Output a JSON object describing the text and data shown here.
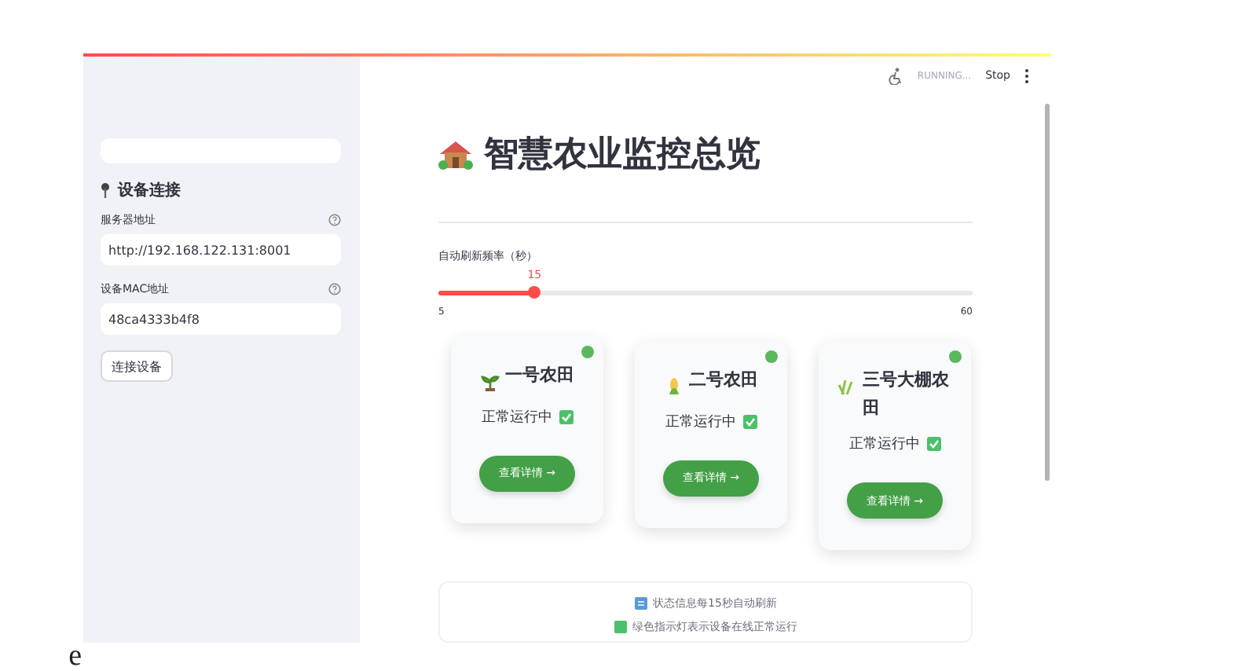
{
  "document": {
    "stray_text": "e"
  },
  "header": {
    "status": "RUNNING...",
    "stop": "Stop"
  },
  "sidebar": {
    "section_title": "设备连接",
    "fields": [
      {
        "label": "服务器地址",
        "value": "http://192.168.122.131:8001"
      },
      {
        "label": "设备MAC地址",
        "value": "48ca4333b4f8"
      }
    ],
    "connect_button": "连接设备"
  },
  "main": {
    "title": "智慧农业监控总览",
    "slider": {
      "label": "自动刷新频率（秒）",
      "value": "15",
      "min": "5",
      "max": "60",
      "level": 0.18
    },
    "cards": [
      {
        "kind": "sprout",
        "name": "一号农田",
        "status": "正常运行中",
        "online": true,
        "button": "查看详情 →"
      },
      {
        "kind": "corn",
        "name": "二号农田",
        "status": "正常运行中",
        "online": true,
        "button": "查看详情 →"
      },
      {
        "kind": "grass",
        "name": "三号大棚农田",
        "status": "正常运行中",
        "online": true,
        "button": "查看详情 →"
      }
    ],
    "info": [
      "状态信息每15秒自动刷新",
      "绿色指示灯表示设备在线正常运行"
    ]
  }
}
